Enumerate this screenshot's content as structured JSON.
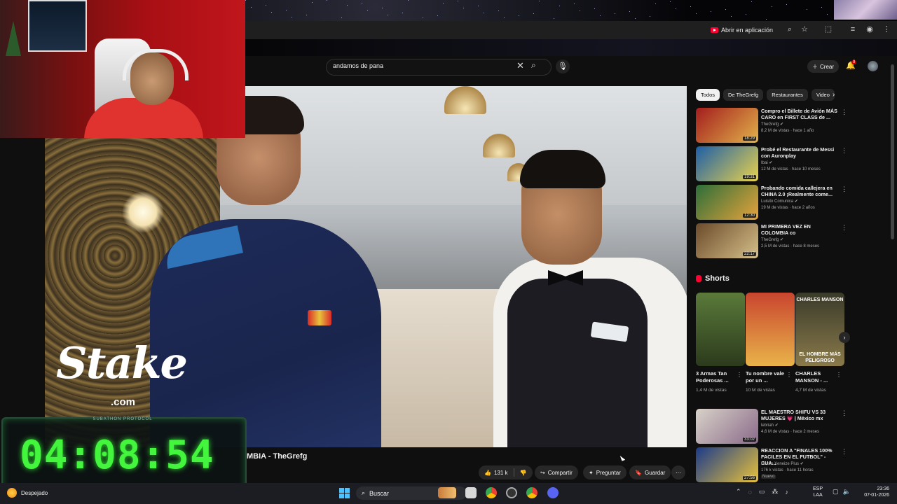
{
  "browser": {
    "open_in_app_label": "Abrir en aplicación",
    "icons": [
      "zoom-icon",
      "bookmark-star-icon",
      "extensions-icon",
      "media-icon",
      "profile-icon",
      "menu-icon"
    ]
  },
  "youtube": {
    "search": {
      "value": "andamos de pana"
    },
    "create_label": "Crear",
    "notification_count": "9",
    "video_title_visible": "MBIA - TheGrefg",
    "actions": {
      "likes": "131 k",
      "share": "Compartir",
      "ask": "Preguntar",
      "save": "Guardar"
    },
    "chips": [
      "Todos",
      "De TheGrefg",
      "Restaurantes",
      "Video"
    ],
    "recommendations": [
      {
        "title": "Compro el Billete de Avión MÁS CARO en FIRST CLASS de ...",
        "channel": "TheGrefg",
        "meta": "8,2 M de vistas · hace 1 año",
        "duration": "18:29",
        "thumb": [
          "#a31d1d",
          "#e2b24a"
        ]
      },
      {
        "title": "Probé el Restaurante de Messi con Auronplay",
        "channel": "Ibai",
        "meta": "12 M de vistas · hace 10 meses",
        "duration": "19:31",
        "thumb": [
          "#1c5ea8",
          "#e9d34c"
        ]
      },
      {
        "title": "Probando comida callejera en CHINA 2.0 ¡Realmente come...",
        "channel": "Luisito Comunica",
        "meta": "19 M de vistas · hace 2 años",
        "duration": "12:30",
        "thumb": [
          "#2c6e3a",
          "#e7a33b"
        ]
      },
      {
        "title": "MI PRIMERA VEZ EN COLOMBIA co",
        "channel": "TheGrefg",
        "meta": "2,5 M de vistas · hace 8 meses",
        "duration": "22:17",
        "thumb": [
          "#6b4a2a",
          "#d6c08a"
        ]
      }
    ],
    "shorts_heading": "Shorts",
    "shorts": [
      {
        "title": "3 Armas Tan Poderosas ...",
        "views": "1,4 M de vistas",
        "overlay": "",
        "thumb": [
          "#5a7a3a",
          "#2c3a1c"
        ]
      },
      {
        "title": "Tu nombre vale por un ...",
        "views": "10 M de vistas",
        "overlay": "",
        "thumb": [
          "#c9452e",
          "#e9b34a"
        ]
      },
      {
        "title": "CHARLES MANSON - ...",
        "views": "4,7 M de vistas",
        "overlay_top": "CHARLES MANSON",
        "overlay": "EL HOMBRE MÁS PELIGROSO",
        "thumb": [
          "#3a3a2a",
          "#8a7a4a"
        ]
      }
    ],
    "more_recommendations": [
      {
        "title": "EL MAESTRO SHIFU VS 33 MUJERES 💗 | México mx",
        "channel": "lebriah",
        "meta": "4,6 M de vistas · hace 2 meses",
        "duration": "33:02",
        "thumb": [
          "#d8d2c8",
          "#8a6a8a"
        ]
      },
      {
        "title": "REACCION A \"FINALES 100% FACILES EN EL FUTBOL\" - CUA...",
        "channel": "Davoo Xeneize Plus",
        "meta": "176 k vistas · hace 11 horas",
        "badge": "Nuevo",
        "duration": "27:56",
        "thumb": [
          "#1b3a8a",
          "#e8c23a"
        ]
      }
    ]
  },
  "overlay": {
    "sponsor": "Stake",
    "sponsor_suffix": ".com",
    "subathon_label": "SUBATHON PROTOCOL",
    "timer": "04:08:54"
  },
  "taskbar": {
    "weather": "Despejado",
    "search_placeholder": "Buscar",
    "lang_top": "ESP",
    "lang_bottom": "LAA",
    "time": "23:36",
    "date": "07-01-2026"
  }
}
